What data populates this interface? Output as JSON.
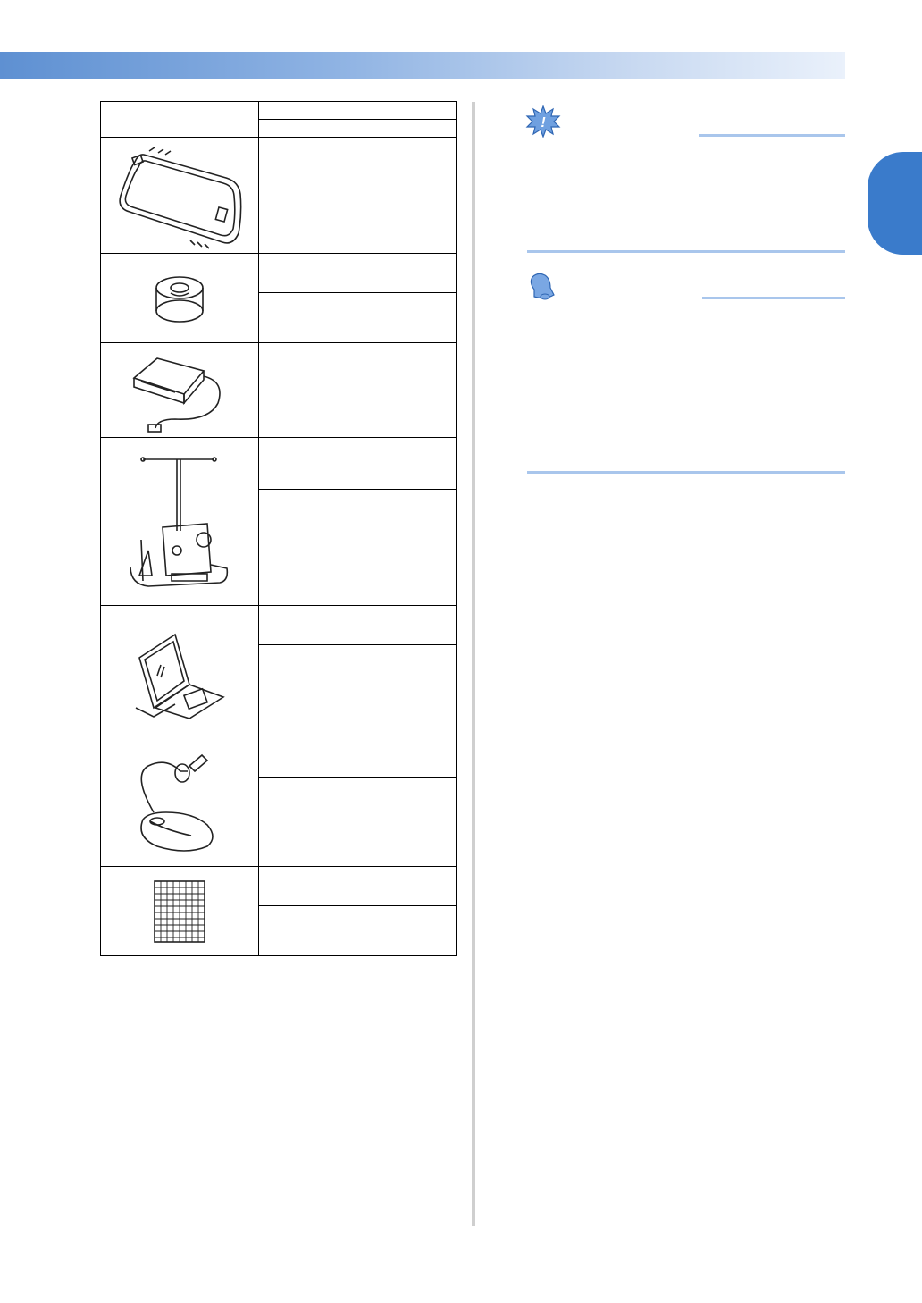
{
  "header": {
    "band_color": "#6e9bd8",
    "tab_color": "#3a7bcb"
  },
  "options_table": {
    "rows": [
      {
        "image": "embroidery-frame-illustration",
        "cells": [
          "",
          ""
        ]
      },
      {
        "image": "bobbin-illustration",
        "cells": [
          "",
          ""
        ]
      },
      {
        "image": "card-reader-illustration",
        "cells": [
          "",
          ""
        ]
      },
      {
        "image": "cap-frame-driver-illustration",
        "cells": [
          "",
          ""
        ]
      },
      {
        "image": "embroidery-card-illustration",
        "cells": [
          "",
          ""
        ]
      },
      {
        "image": "usb-mouse-illustration",
        "cells": [
          "",
          ""
        ]
      },
      {
        "image": "grid-sheet-illustration",
        "cells": [
          "",
          ""
        ]
      }
    ]
  },
  "note": {
    "icon": "note-icon",
    "title": "",
    "text": ""
  },
  "memo": {
    "icon": "memo-bell-icon",
    "title": "",
    "text": ""
  }
}
